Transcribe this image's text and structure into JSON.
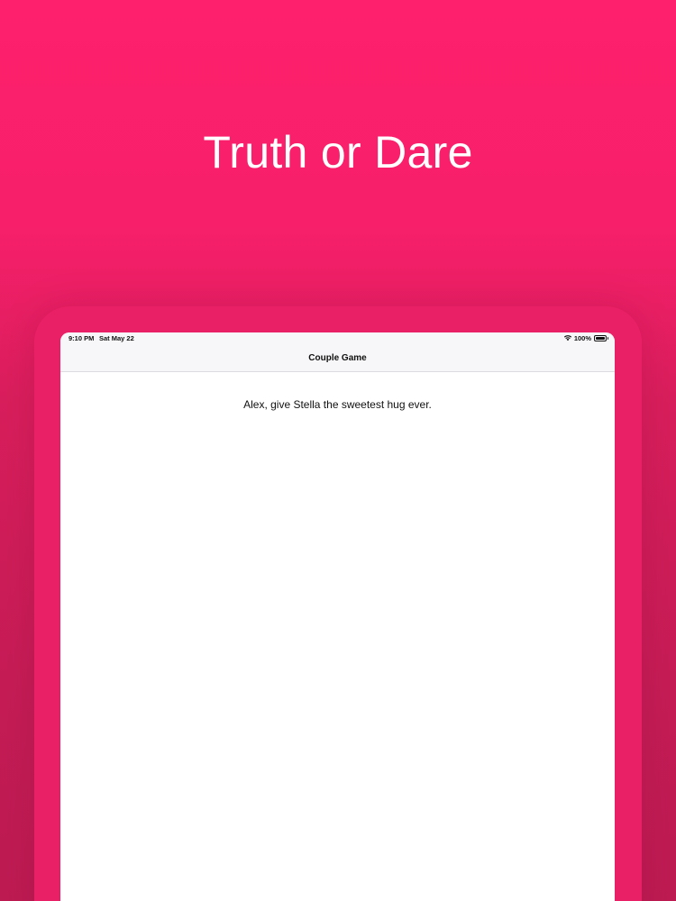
{
  "promo": {
    "headline": "Truth or Dare"
  },
  "status_bar": {
    "time": "9:10 PM",
    "date": "Sat May 22",
    "battery_percent": "100%",
    "wifi_icon": "wifi-icon",
    "battery_icon": "battery-icon"
  },
  "nav": {
    "title": "Couple Game"
  },
  "game": {
    "prompt": "Alex, give Stella the sweetest hug ever."
  },
  "colors": {
    "background_top": "#fe206c",
    "background_bottom": "#bd1b52",
    "device_frame": "#ea2066",
    "bar_background": "#f7f6f8",
    "text": "#111111"
  }
}
